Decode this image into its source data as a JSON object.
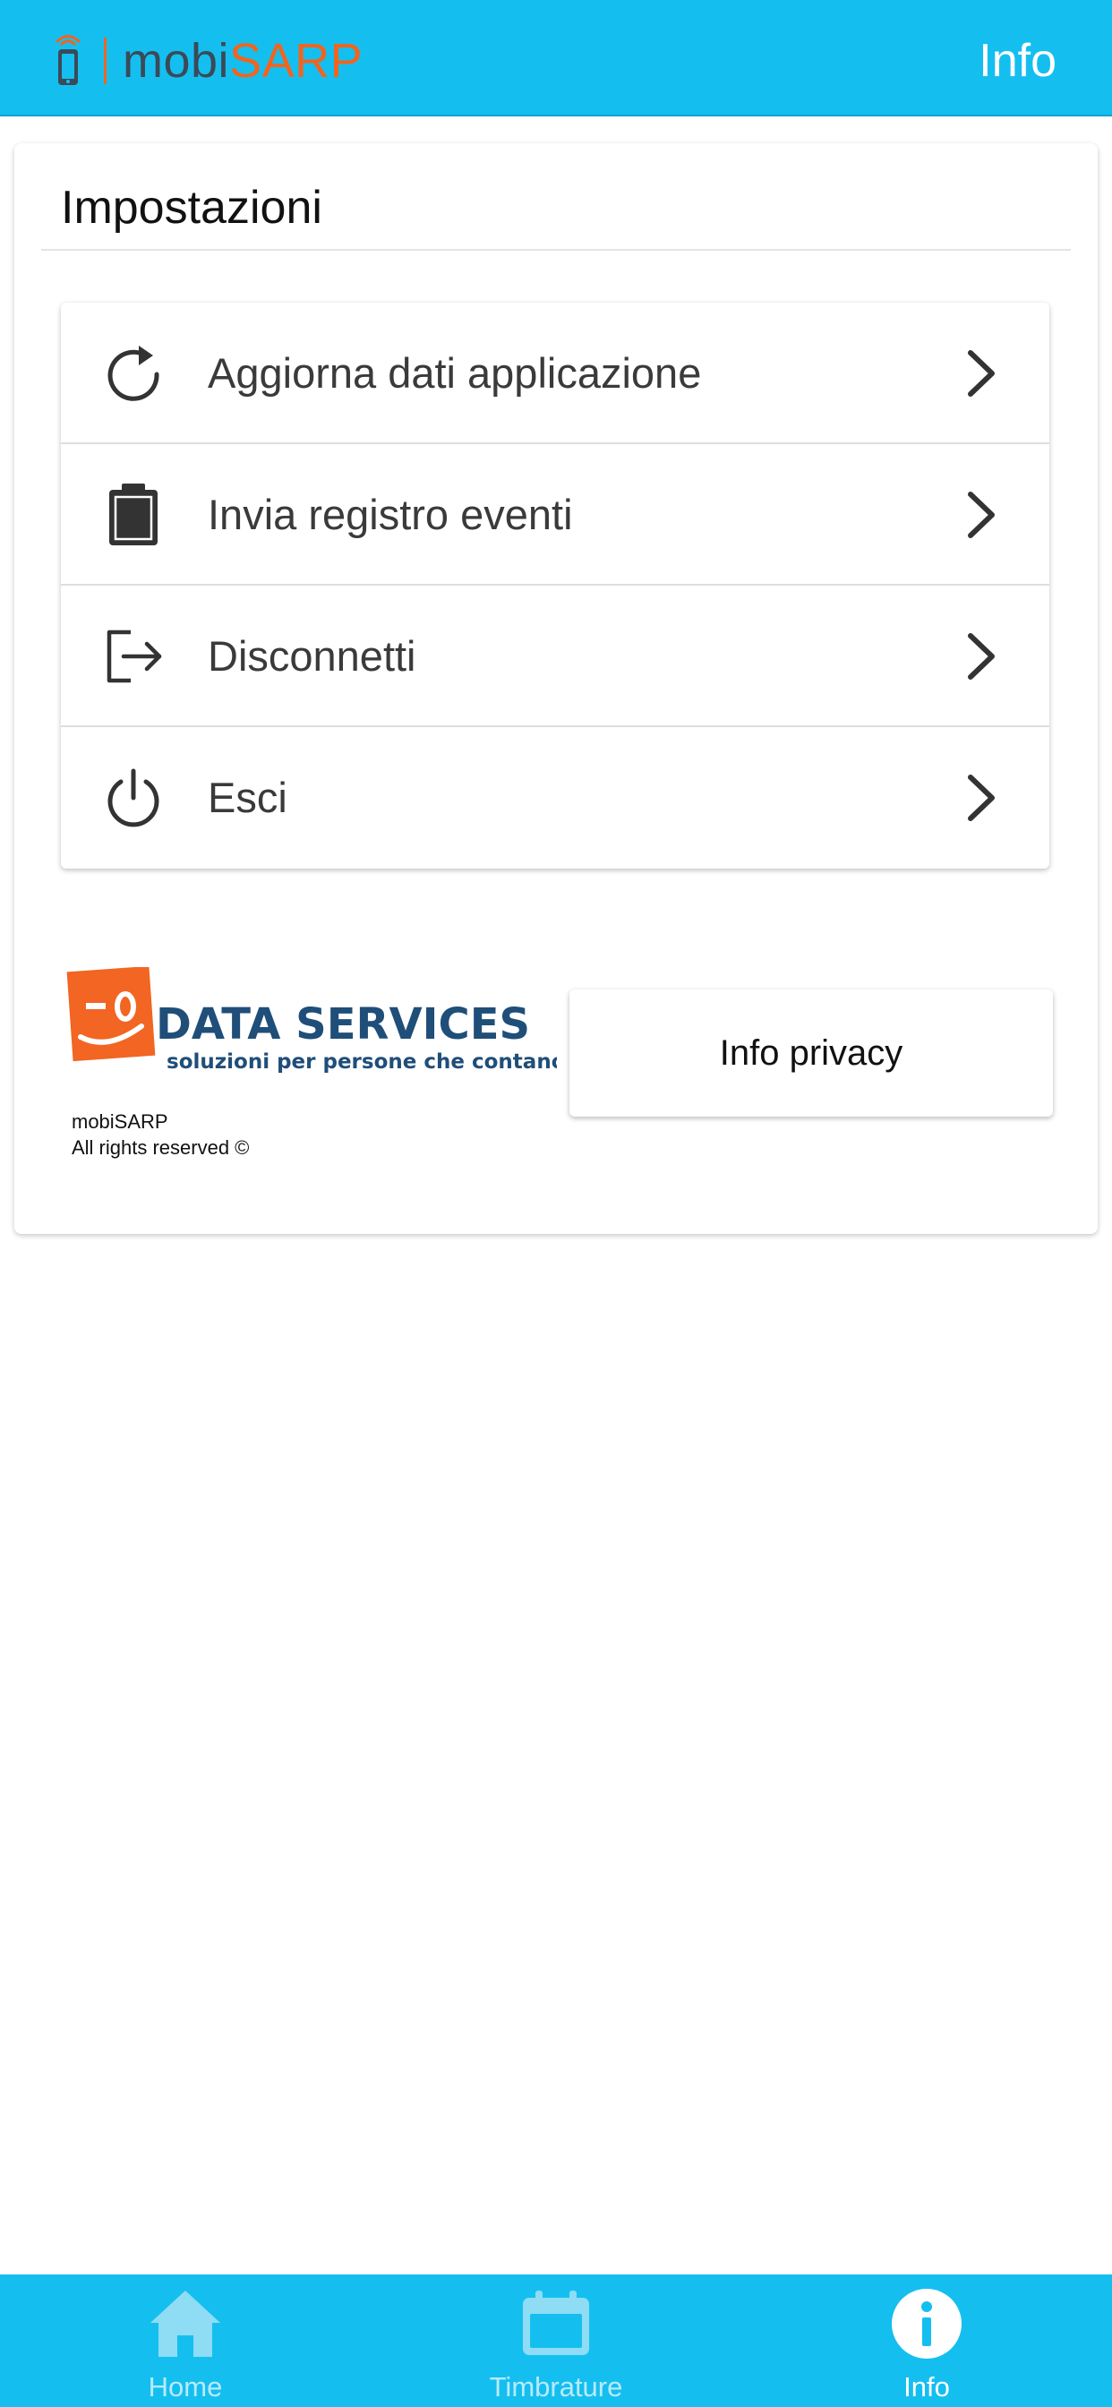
{
  "header": {
    "brand_prefix": "mobi",
    "brand_suffix": "SARP",
    "page_title": "Info"
  },
  "settings": {
    "title": "Impostazioni",
    "items": [
      {
        "label": "Aggiorna dati applicazione",
        "icon": "refresh-icon"
      },
      {
        "label": "Invia registro eventi",
        "icon": "clipboard-icon"
      },
      {
        "label": "Disconnetti",
        "icon": "logout-icon"
      },
      {
        "label": "Esci",
        "icon": "power-icon"
      }
    ]
  },
  "footer": {
    "logo": {
      "name": "DATA SERVICES",
      "tagline": "soluzioni per persone che contano"
    },
    "app_name": "mobiSARP",
    "rights": "All rights reserved ©",
    "privacy_button": "Info privacy"
  },
  "tabs": [
    {
      "label": "Home",
      "icon": "home-icon",
      "active": false
    },
    {
      "label": "Timbrature",
      "icon": "calendar-icon",
      "active": false
    },
    {
      "label": "Info",
      "icon": "info-icon",
      "active": true
    }
  ],
  "colors": {
    "primary": "#14BFF0",
    "brand_accent": "#f2641e",
    "logo_orange": "#f26522",
    "logo_navy": "#1f4e79"
  }
}
